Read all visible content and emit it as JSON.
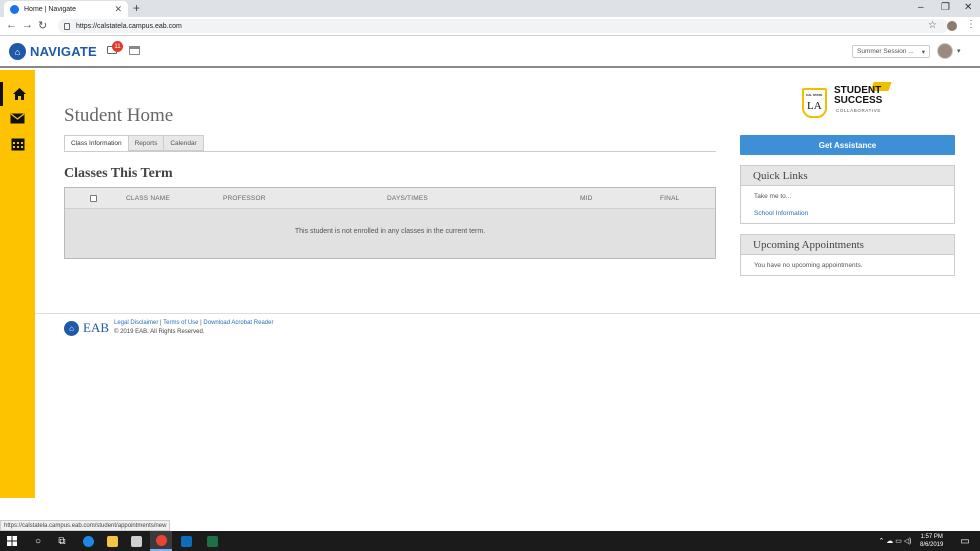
{
  "browser": {
    "tab_title": "Home | Navigate",
    "url": "https://calstatela.campus.eab.com"
  },
  "header": {
    "brand": "NAVIGATE",
    "notification_count": "11",
    "term_select": "Summer Session ..."
  },
  "sidebar": {
    "items": [
      {
        "name": "home"
      },
      {
        "name": "messages"
      },
      {
        "name": "calendar"
      }
    ]
  },
  "main": {
    "title": "Student Home",
    "tabs": [
      "Class Information",
      "Reports",
      "Calendar"
    ],
    "section_title": "Classes This Term",
    "table": {
      "columns": [
        "CLASS NAME",
        "PROFESSOR",
        "DAYS/TIMES",
        "MID",
        "FINAL"
      ],
      "empty_message": "This student is not enrolled in any classes in the current term."
    }
  },
  "right": {
    "brand_shield_top": "CAL STATE",
    "brand_shield_letters": "LA",
    "brand_line1": "STUDENT",
    "brand_line2": "SUCCESS",
    "brand_line3": "COLLABORATIVE",
    "assist_button": "Get Assistance",
    "quick_links": {
      "title": "Quick Links",
      "intro": "Take me to...",
      "link": "School Information"
    },
    "appointments": {
      "title": "Upcoming Appointments",
      "message": "You have no upcoming appointments."
    }
  },
  "footer": {
    "logo_text": "EAB",
    "links": [
      "Legal Disclaimer",
      "Terms of Use",
      "Download Acrobat Reader"
    ],
    "separator": "|",
    "copyright": "© 2019 EAB. All Rights Reserved."
  },
  "status_url": "https://calstatela.campus.eab.com/student/appointments/new",
  "taskbar": {
    "time": "1:57 PM",
    "date": "8/6/2019"
  },
  "colors": {
    "sidebar": "#fdc300",
    "brand_blue": "#1e5aa8",
    "button_blue": "#3d8fd6"
  }
}
